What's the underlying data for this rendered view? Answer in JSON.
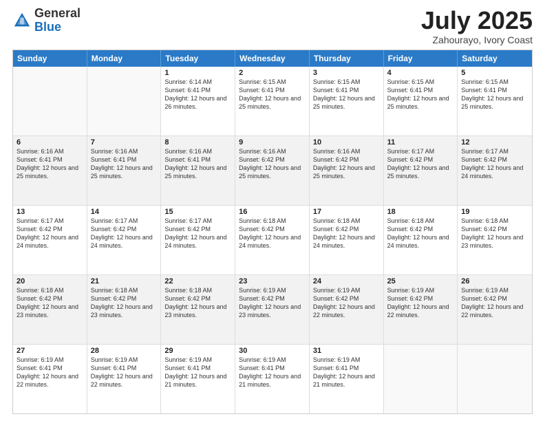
{
  "header": {
    "logo_general": "General",
    "logo_blue": "Blue",
    "title": "July 2025",
    "location": "Zahourayo, Ivory Coast"
  },
  "days_of_week": [
    "Sunday",
    "Monday",
    "Tuesday",
    "Wednesday",
    "Thursday",
    "Friday",
    "Saturday"
  ],
  "weeks": [
    [
      {
        "day": "",
        "info": "",
        "empty": true
      },
      {
        "day": "",
        "info": "",
        "empty": true
      },
      {
        "day": "1",
        "info": "Sunrise: 6:14 AM\nSunset: 6:41 PM\nDaylight: 12 hours and 26 minutes."
      },
      {
        "day": "2",
        "info": "Sunrise: 6:15 AM\nSunset: 6:41 PM\nDaylight: 12 hours and 25 minutes."
      },
      {
        "day": "3",
        "info": "Sunrise: 6:15 AM\nSunset: 6:41 PM\nDaylight: 12 hours and 25 minutes."
      },
      {
        "day": "4",
        "info": "Sunrise: 6:15 AM\nSunset: 6:41 PM\nDaylight: 12 hours and 25 minutes."
      },
      {
        "day": "5",
        "info": "Sunrise: 6:15 AM\nSunset: 6:41 PM\nDaylight: 12 hours and 25 minutes."
      }
    ],
    [
      {
        "day": "6",
        "info": "Sunrise: 6:16 AM\nSunset: 6:41 PM\nDaylight: 12 hours and 25 minutes."
      },
      {
        "day": "7",
        "info": "Sunrise: 6:16 AM\nSunset: 6:41 PM\nDaylight: 12 hours and 25 minutes."
      },
      {
        "day": "8",
        "info": "Sunrise: 6:16 AM\nSunset: 6:41 PM\nDaylight: 12 hours and 25 minutes."
      },
      {
        "day": "9",
        "info": "Sunrise: 6:16 AM\nSunset: 6:42 PM\nDaylight: 12 hours and 25 minutes."
      },
      {
        "day": "10",
        "info": "Sunrise: 6:16 AM\nSunset: 6:42 PM\nDaylight: 12 hours and 25 minutes."
      },
      {
        "day": "11",
        "info": "Sunrise: 6:17 AM\nSunset: 6:42 PM\nDaylight: 12 hours and 25 minutes."
      },
      {
        "day": "12",
        "info": "Sunrise: 6:17 AM\nSunset: 6:42 PM\nDaylight: 12 hours and 24 minutes."
      }
    ],
    [
      {
        "day": "13",
        "info": "Sunrise: 6:17 AM\nSunset: 6:42 PM\nDaylight: 12 hours and 24 minutes."
      },
      {
        "day": "14",
        "info": "Sunrise: 6:17 AM\nSunset: 6:42 PM\nDaylight: 12 hours and 24 minutes."
      },
      {
        "day": "15",
        "info": "Sunrise: 6:17 AM\nSunset: 6:42 PM\nDaylight: 12 hours and 24 minutes."
      },
      {
        "day": "16",
        "info": "Sunrise: 6:18 AM\nSunset: 6:42 PM\nDaylight: 12 hours and 24 minutes."
      },
      {
        "day": "17",
        "info": "Sunrise: 6:18 AM\nSunset: 6:42 PM\nDaylight: 12 hours and 24 minutes."
      },
      {
        "day": "18",
        "info": "Sunrise: 6:18 AM\nSunset: 6:42 PM\nDaylight: 12 hours and 24 minutes."
      },
      {
        "day": "19",
        "info": "Sunrise: 6:18 AM\nSunset: 6:42 PM\nDaylight: 12 hours and 23 minutes."
      }
    ],
    [
      {
        "day": "20",
        "info": "Sunrise: 6:18 AM\nSunset: 6:42 PM\nDaylight: 12 hours and 23 minutes."
      },
      {
        "day": "21",
        "info": "Sunrise: 6:18 AM\nSunset: 6:42 PM\nDaylight: 12 hours and 23 minutes."
      },
      {
        "day": "22",
        "info": "Sunrise: 6:18 AM\nSunset: 6:42 PM\nDaylight: 12 hours and 23 minutes."
      },
      {
        "day": "23",
        "info": "Sunrise: 6:19 AM\nSunset: 6:42 PM\nDaylight: 12 hours and 23 minutes."
      },
      {
        "day": "24",
        "info": "Sunrise: 6:19 AM\nSunset: 6:42 PM\nDaylight: 12 hours and 22 minutes."
      },
      {
        "day": "25",
        "info": "Sunrise: 6:19 AM\nSunset: 6:42 PM\nDaylight: 12 hours and 22 minutes."
      },
      {
        "day": "26",
        "info": "Sunrise: 6:19 AM\nSunset: 6:42 PM\nDaylight: 12 hours and 22 minutes."
      }
    ],
    [
      {
        "day": "27",
        "info": "Sunrise: 6:19 AM\nSunset: 6:41 PM\nDaylight: 12 hours and 22 minutes."
      },
      {
        "day": "28",
        "info": "Sunrise: 6:19 AM\nSunset: 6:41 PM\nDaylight: 12 hours and 22 minutes."
      },
      {
        "day": "29",
        "info": "Sunrise: 6:19 AM\nSunset: 6:41 PM\nDaylight: 12 hours and 21 minutes."
      },
      {
        "day": "30",
        "info": "Sunrise: 6:19 AM\nSunset: 6:41 PM\nDaylight: 12 hours and 21 minutes."
      },
      {
        "day": "31",
        "info": "Sunrise: 6:19 AM\nSunset: 6:41 PM\nDaylight: 12 hours and 21 minutes."
      },
      {
        "day": "",
        "info": "",
        "empty": true
      },
      {
        "day": "",
        "info": "",
        "empty": true
      }
    ]
  ]
}
